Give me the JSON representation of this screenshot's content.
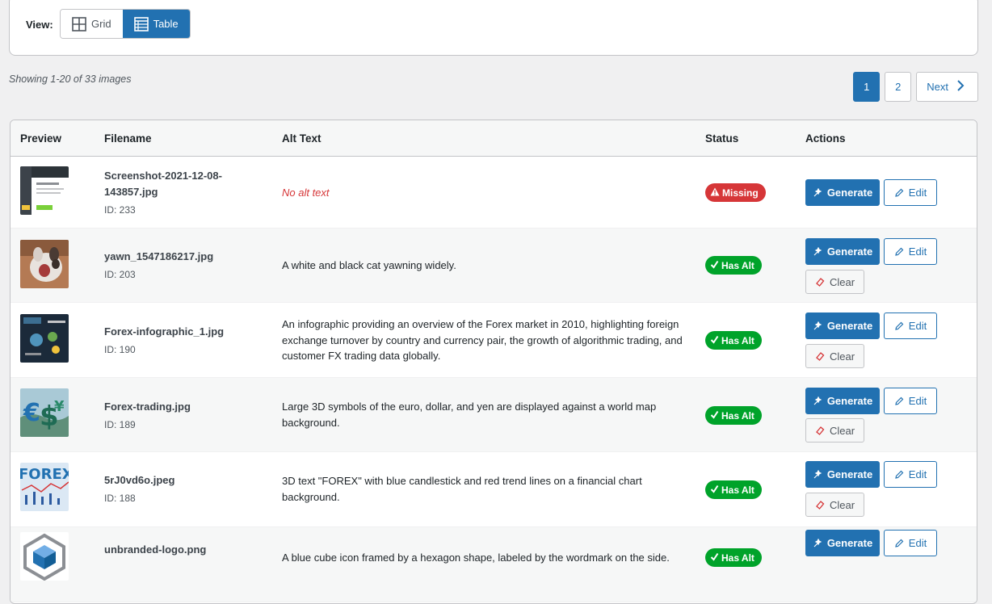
{
  "view": {
    "label": "View:",
    "options": [
      {
        "label": "Grid",
        "icon": "grid-icon",
        "active": false
      },
      {
        "label": "Table",
        "icon": "table-icon",
        "active": true
      }
    ]
  },
  "summary": "Showing 1-20 of 33 images",
  "pagination": {
    "pages": [
      "1",
      "2"
    ],
    "current": "1",
    "next_label": "Next"
  },
  "table": {
    "headers": {
      "preview": "Preview",
      "filename": "Filename",
      "alt_text": "Alt Text",
      "status": "Status",
      "actions": "Actions"
    },
    "actions": {
      "generate": "Generate",
      "edit": "Edit",
      "clear": "Clear"
    },
    "rows": [
      {
        "filename": "Screenshot-2021-12-08-143857.jpg",
        "id": "ID: 233",
        "alt": "No alt text",
        "status": "Missing",
        "has_alt": false,
        "thumb": "screenshot"
      },
      {
        "filename": "yawn_1547186217.jpg",
        "id": "ID: 203",
        "alt": "A white and black cat yawning widely.",
        "status": "Has Alt",
        "has_alt": true,
        "thumb": "cat"
      },
      {
        "filename": "Forex-infographic_1.jpg",
        "id": "ID: 190",
        "alt": "An infographic providing an overview of the Forex market in 2010, highlighting foreign exchange turnover by country and currency pair, the growth of algorithmic trading, and customer FX trading data globally.",
        "status": "Has Alt",
        "has_alt": true,
        "thumb": "infographic"
      },
      {
        "filename": "Forex-trading.jpg",
        "id": "ID: 189",
        "alt": "Large 3D symbols of the euro, dollar, and yen are displayed against a world map background.",
        "status": "Has Alt",
        "has_alt": true,
        "thumb": "currency"
      },
      {
        "filename": "5rJ0vd6o.jpeg",
        "id": "ID: 188",
        "alt": "3D text \"FOREX\" with blue candlestick and red trend lines on a financial chart background.",
        "status": "Has Alt",
        "has_alt": true,
        "thumb": "forex-text"
      },
      {
        "filename": "unbranded-logo.png",
        "id": "",
        "alt": "A blue cube icon framed by a hexagon shape, labeled by the wordmark on the side.",
        "status": "Has Alt",
        "has_alt": true,
        "thumb": "logo"
      }
    ]
  },
  "colors": {
    "primary": "#2271b1",
    "missing": "#d63638",
    "has_alt": "#00a32a",
    "background": "#f0f0f1"
  }
}
